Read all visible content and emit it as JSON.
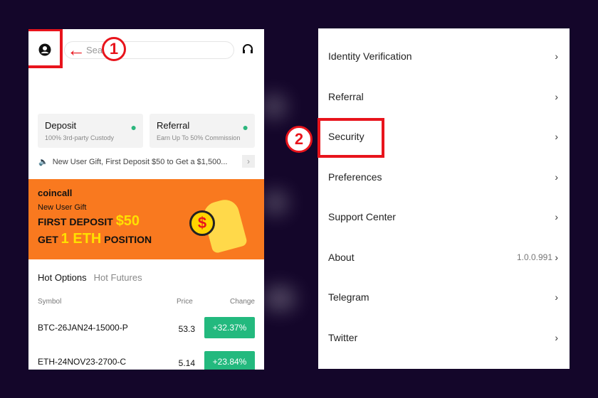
{
  "left": {
    "search_placeholder": "Search",
    "step1": "1",
    "cards": [
      {
        "title": "Deposit",
        "subtitle": "100% 3rd-party Custody"
      },
      {
        "title": "Referral",
        "subtitle": "Earn Up To 50% Commission"
      }
    ],
    "notice": "New User Gift, First Deposit $50 to Get a $1,500...",
    "banner": {
      "logo": "coincall",
      "gift": "New User Gift",
      "line1": "FIRST DEPOSIT",
      "amount": "$50",
      "line2a": "GET",
      "eth": "1 ETH",
      "line2b": "POSITION"
    },
    "tabs": [
      "Hot Options",
      "Hot Futures"
    ],
    "headers": {
      "symbol": "Symbol",
      "price": "Price",
      "change": "Change"
    },
    "rows": [
      {
        "symbol": "BTC-26JAN24-15000-P",
        "price": "53.3",
        "change": "+32.37%"
      },
      {
        "symbol": "ETH-24NOV23-2700-C",
        "price": "5.14",
        "change": "+23.84%"
      }
    ]
  },
  "right": {
    "step2": "2",
    "items": [
      {
        "label": "Identity Verification"
      },
      {
        "label": "Referral"
      },
      {
        "label": "Security"
      },
      {
        "label": "Preferences"
      },
      {
        "label": "Support Center"
      },
      {
        "label": "About",
        "value": "1.0.0.991"
      },
      {
        "label": "Telegram"
      },
      {
        "label": "Twitter"
      }
    ]
  },
  "colors": {
    "highlight": "#e8141c",
    "positive": "#23b97e",
    "banner": "#f9791f",
    "background": "#14062a"
  }
}
